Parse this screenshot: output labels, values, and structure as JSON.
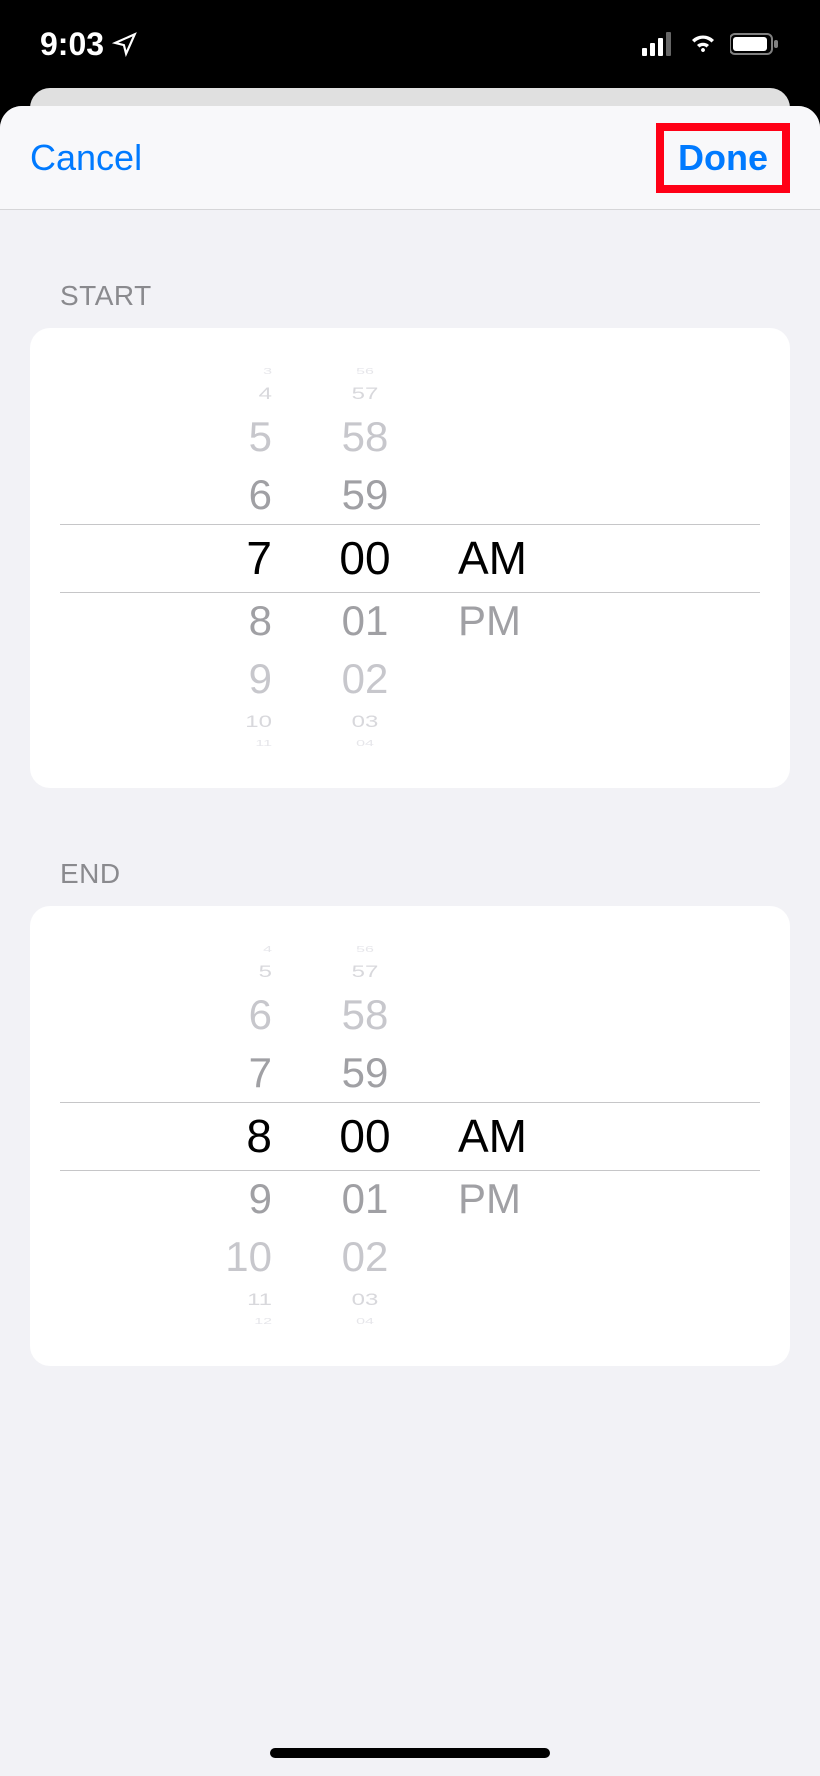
{
  "statusBar": {
    "time": "9:03"
  },
  "modal": {
    "cancel": "Cancel",
    "done": "Done"
  },
  "sections": {
    "start": {
      "label": "START",
      "hours": {
        "minus4": "3",
        "minus3": "4",
        "minus2": "5",
        "minus1": "6",
        "selected": "7",
        "plus1": "8",
        "plus2": "9",
        "plus3": "10",
        "plus4": "11"
      },
      "minutes": {
        "minus4": "56",
        "minus3": "57",
        "minus2": "58",
        "minus1": "59",
        "selected": "00",
        "plus1": "01",
        "plus2": "02",
        "plus3": "03",
        "plus4": "04"
      },
      "period": {
        "selected": "AM",
        "other": "PM"
      }
    },
    "end": {
      "label": "END",
      "hours": {
        "minus4": "4",
        "minus3": "5",
        "minus2": "6",
        "minus1": "7",
        "selected": "8",
        "plus1": "9",
        "plus2": "10",
        "plus3": "11",
        "plus4": "12"
      },
      "minutes": {
        "minus4": "56",
        "minus3": "57",
        "minus2": "58",
        "minus1": "59",
        "selected": "00",
        "plus1": "01",
        "plus2": "02",
        "plus3": "03",
        "plus4": "04"
      },
      "period": {
        "selected": "AM",
        "other": "PM"
      }
    }
  }
}
